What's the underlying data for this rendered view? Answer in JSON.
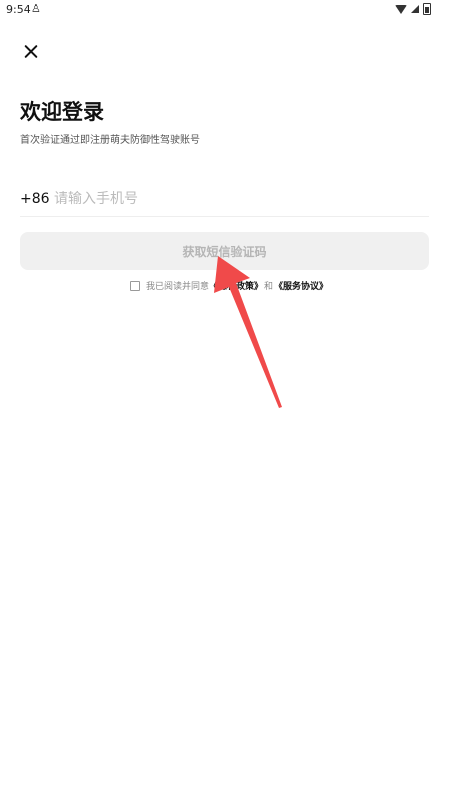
{
  "status_bar": {
    "time": "9:54",
    "person_glyph": "♙",
    "icons": [
      "wifi-icon",
      "signal-icon",
      "battery-icon"
    ]
  },
  "header": {
    "close_icon": "close-icon"
  },
  "login": {
    "title": "欢迎登录",
    "subtitle": "首次验证通过即注册萌夫防御性驾驶账号",
    "country_code": "+86",
    "phone_placeholder": "请输入手机号",
    "sms_button_label": "获取短信验证码"
  },
  "agreement": {
    "prefix": "我已阅读并同意",
    "privacy_link": "《隐私政策》",
    "and": "和",
    "service_link": "《服务协议》"
  },
  "annotation": {
    "arrow_color": "#f04a4a"
  }
}
